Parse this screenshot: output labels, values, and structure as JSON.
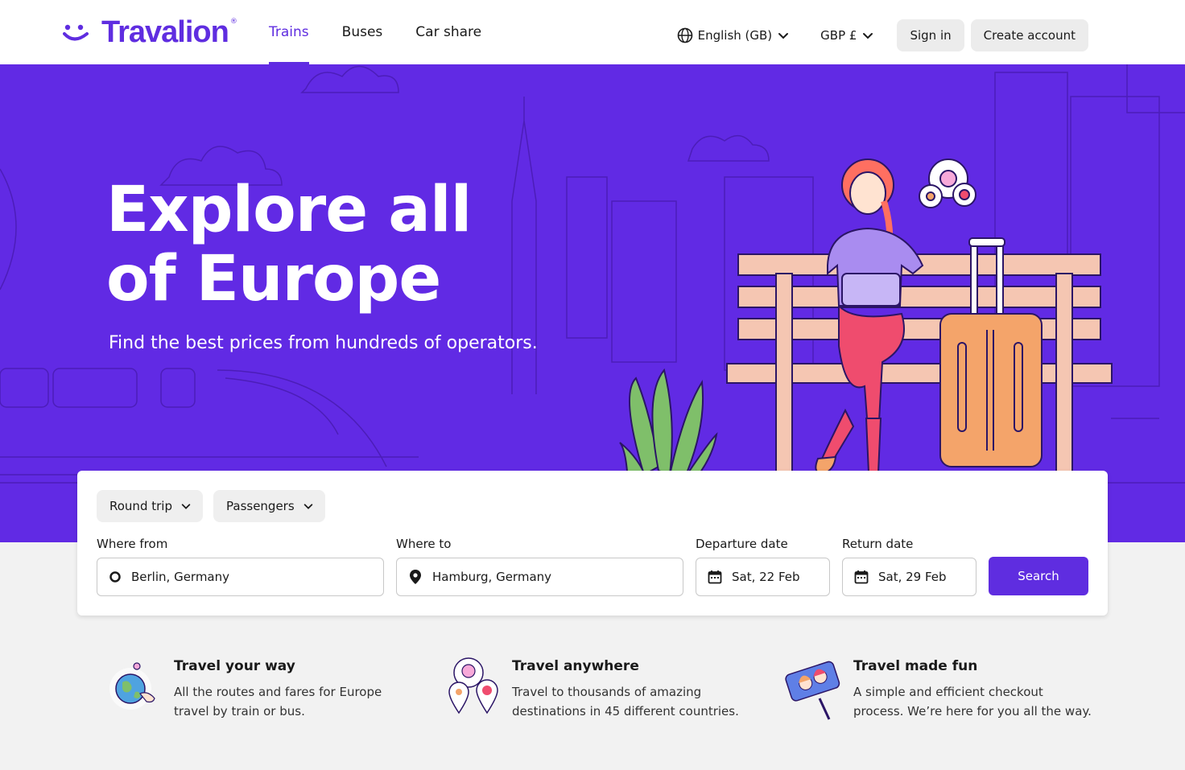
{
  "brand": {
    "name": "Travalion",
    "reg": "®",
    "color": "#5f2de0"
  },
  "nav": {
    "items": [
      {
        "label": "Trains",
        "active": true
      },
      {
        "label": "Buses",
        "active": false
      },
      {
        "label": "Car share",
        "active": false
      }
    ]
  },
  "header": {
    "language": "English (GB)",
    "currency": "GBP £",
    "sign_in": "Sign in",
    "create_account": "Create account"
  },
  "hero": {
    "title_line1": "Explore all",
    "title_line2": "of Europe",
    "subtitle": "Find the best prices from hundreds of operators.",
    "bg_color": "#612ae4"
  },
  "search": {
    "trip_type": "Round trip",
    "passengers": "Passengers",
    "from_label": "Where from",
    "from_value": "Berlin, Germany",
    "to_label": "Where to",
    "to_value": "Hamburg, Germany",
    "departure_label": "Departure date",
    "departure_value": "Sat, 22 Feb",
    "return_label": "Return date",
    "return_value": "Sat, 29 Feb",
    "button": "Search"
  },
  "features": [
    {
      "title": "Travel your way",
      "description": "All the routes and fares for Europe travel by train or bus.",
      "icon": "globe-hand-icon"
    },
    {
      "title": "Travel anywhere",
      "description": "Travel to thousands of amazing destinations in 45 different countries.",
      "icon": "map-pins-icon"
    },
    {
      "title": "Travel made fun",
      "description": "A simple and efficient checkout process. We’re here for you all the way.",
      "icon": "selfie-stick-icon"
    }
  ]
}
